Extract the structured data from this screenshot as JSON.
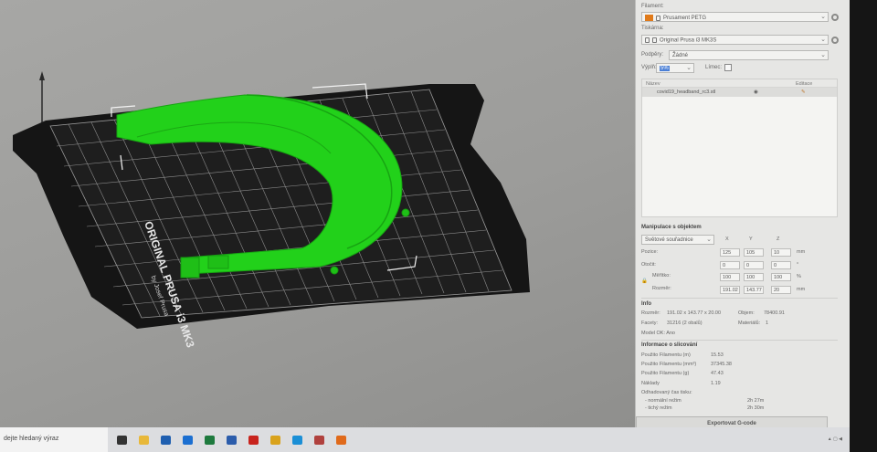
{
  "colors": {
    "accent_filament": "#e07a1a",
    "model_green": "#22d11a",
    "bed_dark": "#141414"
  },
  "bed": {
    "brand": "ORIGINAL PRUSA i3 MK3",
    "byline": "by Josef Prusa"
  },
  "panel": {
    "filament_label": "Filament:",
    "filament_value": "Prusament PETG",
    "printer_label": "Tiskárna:",
    "printer_value": "Original Prusa i3 MK3S",
    "supports_label": "Podpěry:",
    "supports_value": "Žádné",
    "infill_label": "Výplň:",
    "infill_value": "5%",
    "brim_label": "Límec:",
    "list_header_name": "Název",
    "list_header_edit": "Editace",
    "object_name": "covid19_headband_rc3.stl",
    "manip_title": "Manipulace s objektem",
    "coord_mode": "Světové souřadnice",
    "col_x": "X",
    "col_y": "Y",
    "col_z": "Z",
    "pos_label": "Pozice:",
    "pos": [
      "125",
      "105",
      "10"
    ],
    "pos_unit": "mm",
    "rot_label": "Otočit:",
    "rot": [
      "0",
      "0",
      "0"
    ],
    "rot_unit": "°",
    "scale_label": "Měřítko:",
    "scale": [
      "100",
      "100",
      "100"
    ],
    "scale_unit": "%",
    "size_label": "Rozměr:",
    "size": [
      "191.02",
      "143.77",
      "20"
    ],
    "size_unit": "mm",
    "info_title": "Info",
    "info_size_label": "Rozměr:",
    "info_size_value": "191.02 x 143.77 x 20.00",
    "info_volume_label": "Objem:",
    "info_volume_value": "78400.91",
    "info_facets_label": "Facety:",
    "info_facets_value": "31216 (2 obalů)",
    "info_mat_label": "Materiálů:",
    "info_mat_value": "1",
    "info_model_ok": "Model OK: Ano",
    "slice_title": "Informace o slicování",
    "fil_m_label": "Použito Filamentu (m)",
    "fil_m_value": "15.53",
    "fil_mm3_label": "Použito Filamentu (mm³)",
    "fil_mm3_value": "37345.38",
    "fil_g_label": "Použito Filamentu (g)",
    "fil_g_value": "47.43",
    "cost_label": "Náklady",
    "cost_value": "1.19",
    "time_label": "Odhadovaný čas tisku:",
    "normal_label": "- normální režim",
    "normal_value": "2h 27m",
    "silent_label": "- tichý režim",
    "silent_value": "2h 30m",
    "export_label": "Exportovat G-code"
  },
  "taskbar": {
    "search_text": "dejte hledaný výraz",
    "icons": [
      {
        "name": "task-view-icon",
        "color": "#333333"
      },
      {
        "name": "file-explorer-icon",
        "color": "#e8b83a"
      },
      {
        "name": "mail-icon",
        "color": "#1f5fb0"
      },
      {
        "name": "edge-icon",
        "color": "#1c6fd1"
      },
      {
        "name": "excel-icon",
        "color": "#1e7a3e"
      },
      {
        "name": "word-icon",
        "color": "#2b5cab"
      },
      {
        "name": "acrobat-icon",
        "color": "#c8231d"
      },
      {
        "name": "chrome-icon",
        "color": "#d9a21c"
      },
      {
        "name": "skype-icon",
        "color": "#1b8fd6"
      },
      {
        "name": "tool-icon",
        "color": "#b0413e"
      },
      {
        "name": "prusaslicer-icon",
        "color": "#e06a1b"
      }
    ]
  }
}
